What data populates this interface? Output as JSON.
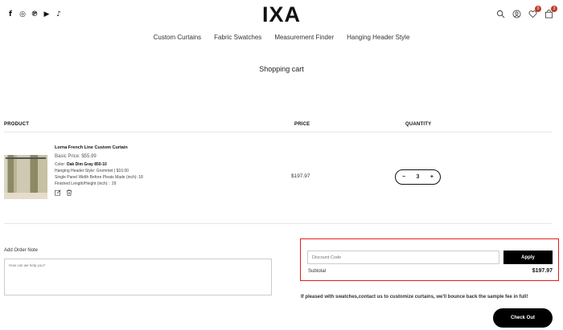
{
  "header": {
    "brand": "IXA",
    "social": [
      {
        "icon": "facebook-icon",
        "glyph": "f"
      },
      {
        "icon": "instagram-icon",
        "glyph": "◎"
      },
      {
        "icon": "pinterest-icon",
        "glyph": "℗"
      },
      {
        "icon": "youtube-icon",
        "glyph": "▶"
      },
      {
        "icon": "tiktok-icon",
        "glyph": "♪"
      }
    ],
    "wishlist_count": "0",
    "cart_count": "3"
  },
  "nav": {
    "items": [
      "Custom Curtains",
      "Fabric Swatches",
      "Measurement Finder",
      "Hanging Header Style"
    ]
  },
  "cart": {
    "title": "Shopping cart",
    "col_product": "PRODUCT",
    "col_price": "PRICE",
    "col_quantity": "QUANTITY",
    "item": {
      "name": "Lorna French Line Custom Curtain",
      "basic_price": "Basic Price: $55.99",
      "color_label": "Color:",
      "color_value": "Oak Dim Gray 850-10",
      "header_style": "Hanging Header Style: Grommet | $10.00",
      "panel_width": "Single Panel Width Before Pleats Made (inch): 18",
      "finished_length": "Finished Length/Height (inch): : 29",
      "price": "$197.97",
      "quantity": "3",
      "minus": "−",
      "plus": "+"
    }
  },
  "order_note": {
    "label": "Add Order Note",
    "placeholder": "How can we help you?"
  },
  "summary": {
    "discount_placeholder": "Discount Code",
    "apply_label": "Apply",
    "subtotal_label": "Subtotal",
    "subtotal_value": "$197.97",
    "promo_text": "If pleased with swatches,contact us to customize curtains, we'll bounce back the sample fee in full!",
    "checkout_label": "Check Out"
  },
  "colors": {
    "highlight": "#e02020",
    "badge": "#c0392b",
    "button": "#000000"
  }
}
